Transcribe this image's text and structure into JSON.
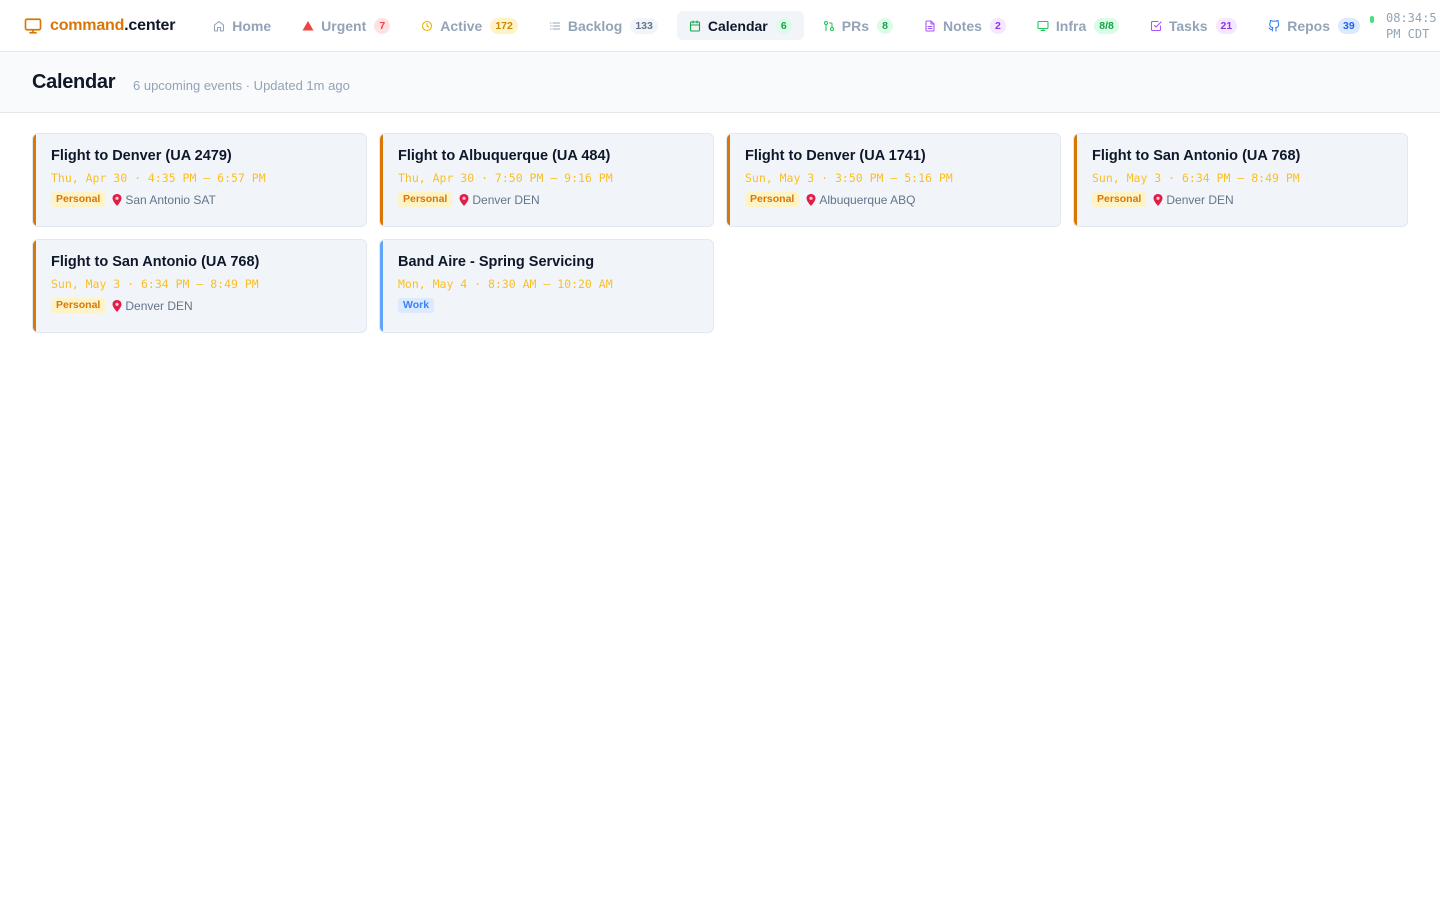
{
  "brand": {
    "part1": "command",
    "part2": ".center",
    "icon": "monitor-icon"
  },
  "nav": [
    {
      "label": "Home",
      "badge": null,
      "icon": "home-icon",
      "icon_color": "#94a3b8",
      "badge_bg": "",
      "badge_fg": "",
      "active": false
    },
    {
      "label": "Urgent",
      "badge": "7",
      "icon": "alert-triangle-icon",
      "icon_color": "#ef4444",
      "badge_bg": "#fee2e2",
      "badge_fg": "#ef4444",
      "active": false
    },
    {
      "label": "Active",
      "badge": "172",
      "icon": "clock-icon",
      "icon_color": "#eab308",
      "badge_bg": "#fef3c7",
      "badge_fg": "#ca8a04",
      "active": false
    },
    {
      "label": "Backlog",
      "badge": "133",
      "icon": "list-icon",
      "icon_color": "#94a3b8",
      "badge_bg": "#f1f5f9",
      "badge_fg": "#64748b",
      "active": false
    },
    {
      "label": "Calendar",
      "badge": "6",
      "icon": "calendar-icon",
      "icon_color": "#16a34a",
      "badge_bg": "#dcfce7",
      "badge_fg": "#16a34a",
      "active": true
    },
    {
      "label": "PRs",
      "badge": "8",
      "icon": "git-pull-request-icon",
      "icon_color": "#22c55e",
      "badge_bg": "#dcfce7",
      "badge_fg": "#16a34a",
      "active": false
    },
    {
      "label": "Notes",
      "badge": "2",
      "icon": "file-text-icon",
      "icon_color": "#a855f7",
      "badge_bg": "#f3e8ff",
      "badge_fg": "#9333ea",
      "active": false
    },
    {
      "label": "Infra",
      "badge": "8/8",
      "icon": "monitor-icon",
      "icon_color": "#22c55e",
      "badge_bg": "#dcfce7",
      "badge_fg": "#16a34a",
      "active": false
    },
    {
      "label": "Tasks",
      "badge": "21",
      "icon": "check-square-icon",
      "icon_color": "#a855f7",
      "badge_bg": "#f3e8ff",
      "badge_fg": "#9333ea",
      "active": false
    },
    {
      "label": "Repos",
      "badge": "39",
      "icon": "github-icon",
      "icon_color": "#3b82f6",
      "badge_bg": "#dbeafe",
      "badge_fg": "#2563eb",
      "active": false
    }
  ],
  "clock": {
    "line1": "08:34:5",
    "line2": "PM CDT"
  },
  "page": {
    "title": "Calendar",
    "subtitle": "6 upcoming events · Updated 1m ago"
  },
  "colors": {
    "accent": "#d97706",
    "personal_tag_bg": "#fef3c7",
    "personal_tag_fg": "#d97706",
    "work_tag_bg": "#dbeafe",
    "work_tag_fg": "#3b82f6",
    "personal_time": "#fbbf24",
    "work_time": "#fbbf24"
  },
  "events": [
    {
      "title": "Flight to Denver (UA 2479)",
      "time": "Thu, Apr 30 · 4:35 PM – 6:57 PM",
      "tag": "Personal",
      "location": "San Antonio SAT",
      "kind": "personal"
    },
    {
      "title": "Flight to Albuquerque (UA 484)",
      "time": "Thu, Apr 30 · 7:50 PM – 9:16 PM",
      "tag": "Personal",
      "location": "Denver DEN",
      "kind": "personal"
    },
    {
      "title": "Flight to Denver (UA 1741)",
      "time": "Sun, May 3 · 3:50 PM – 5:16 PM",
      "tag": "Personal",
      "location": "Albuquerque ABQ",
      "kind": "personal"
    },
    {
      "title": "Flight to San Antonio (UA 768)",
      "time": "Sun, May 3 · 6:34 PM – 8:49 PM",
      "tag": "Personal",
      "location": "Denver DEN",
      "kind": "personal"
    },
    {
      "title": "Flight to San Antonio (UA 768)",
      "time": "Sun, May 3 · 6:34 PM – 8:49 PM",
      "tag": "Personal",
      "location": "Denver DEN",
      "kind": "personal"
    },
    {
      "title": "Band Aire - Spring Servicing",
      "time": "Mon, May 4 · 8:30 AM – 10:20 AM",
      "tag": "Work",
      "location": null,
      "kind": "work"
    }
  ]
}
